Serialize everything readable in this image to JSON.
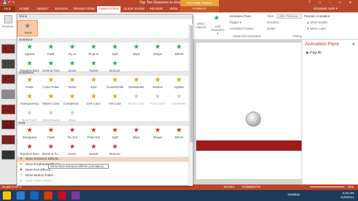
{
  "window": {
    "title": "Top Ten Reasons to Hire Me EAN - PowerPoint",
    "picture_tools": "PICTURE TOOLS",
    "controls": "? ▭ – □ ✕",
    "qat": "💾 ↶ ↷"
  },
  "tabs": [
    "FILE",
    "HOME",
    "INSERT",
    "DESIGN",
    "TRANSITIONS",
    "ANIMATIONS",
    "SLIDE SHOW",
    "REVIEW",
    "VIEW",
    "FORMAT"
  ],
  "user": "Elizabeth Nofs ▾",
  "ribbon": {
    "preview": "Preview",
    "effect_options": "Effect Options",
    "add_animation": "Add Animation ▾",
    "animation_pane": "Animation Pane",
    "trigger": "Trigger ▾",
    "animation_painter": "Animation Painter",
    "advanced_group": "Advanced Animation",
    "start_label": "Start:",
    "start_value": "After Previous",
    "duration_label": "Duration:",
    "delay_label": "Delay:",
    "reorder_title": "Reorder Animation",
    "move_earlier": "▲ Move Earlier",
    "move_later": "▼ Move Later",
    "timing_group": "Timing"
  },
  "gallery": {
    "sections": {
      "none": "None",
      "entrance": "Entrance",
      "emphasis": "Emphasis",
      "exit": "Exit"
    },
    "none_item": "None",
    "entrance": [
      "Appear",
      "Fade",
      "Fly In",
      "Float In",
      "Split",
      "Wipe",
      "Shape",
      "Wheel",
      "Random Bars",
      "Grow & Turn",
      "Zoom",
      "Swivel",
      "Bounce"
    ],
    "emphasis": [
      "Pulse",
      "Color Pulse",
      "Teeter",
      "Spin",
      "Grow/Shrink",
      "Desaturate",
      "Darken",
      "Lighten",
      "Transparency",
      "Object Color",
      "Compleme...",
      "Line Color",
      "Fill Color",
      "Brush Color",
      "Font Color",
      "Underline",
      "Bold Flash",
      "Bold Reveal",
      "Wave"
    ],
    "exit": [
      "Disappear",
      "Fade",
      "Fly Out",
      "Float Out",
      "Split",
      "Wipe",
      "Shape",
      "Wheel",
      "Random Bars",
      "Shrink & Tu...",
      "Zoom",
      "Swivel",
      "Bounce"
    ],
    "more": [
      "More Entrance Effects...",
      "More Emphasis Effects...",
      "More Exit Effects...",
      "More Motion Paths...",
      "OLE Action Verbs..."
    ],
    "tooltip": "Show More Entrance Effects (Animation)"
  },
  "pane": {
    "title": "Animation Pane",
    "play_all": "▶ Play All",
    "close": "✕"
  },
  "status": {
    "left": "SLIDE 8 OF 9",
    "notes": "NOTES",
    "comments": "COMMENTS",
    "zoom": "48%"
  },
  "taskbar": {
    "desktop": "Desktop",
    "time": "5:40 AM",
    "date": "11/6/2013"
  },
  "colors": {
    "accent": "#b7472a",
    "entrance": "#3aa64c",
    "emphasis": "#e5a300",
    "exit": "#c0392b",
    "disabled": "#cccccc"
  }
}
